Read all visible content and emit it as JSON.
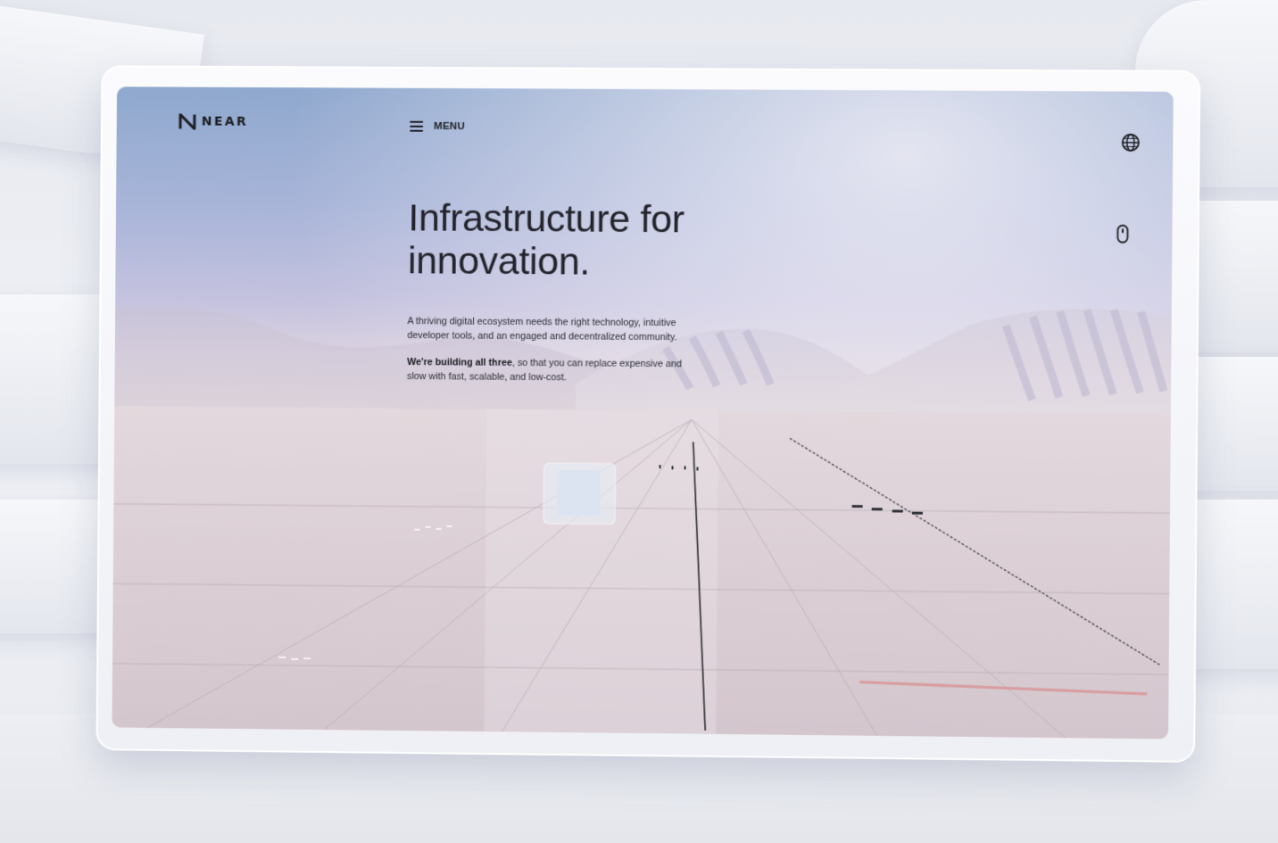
{
  "brand": {
    "name": "NEAR",
    "logo_icon": "near-n-logo-icon"
  },
  "nav": {
    "menu_label": "MENU",
    "menu_icon": "hamburger-icon",
    "language_icon": "globe-icon"
  },
  "hero": {
    "title_line1": "Infrastructure for",
    "title_line2": "innovation.",
    "paragraph1": "A thriving digital ecosystem needs the right technology, intuitive developer tools, and an engaged and decentralized community.",
    "paragraph2_bold": "We're building all three",
    "paragraph2_rest": ", so that you can replace expensive and slow with fast, scalable, and low-cost."
  },
  "scroll_indicator_icon": "mouse-scroll-icon",
  "colors": {
    "text": "#23242b",
    "sky_top": "#8fa8ce",
    "sky_mid": "#c4c2df",
    "ground": "#dcd0d6",
    "accent_line": "#d88a8a"
  }
}
